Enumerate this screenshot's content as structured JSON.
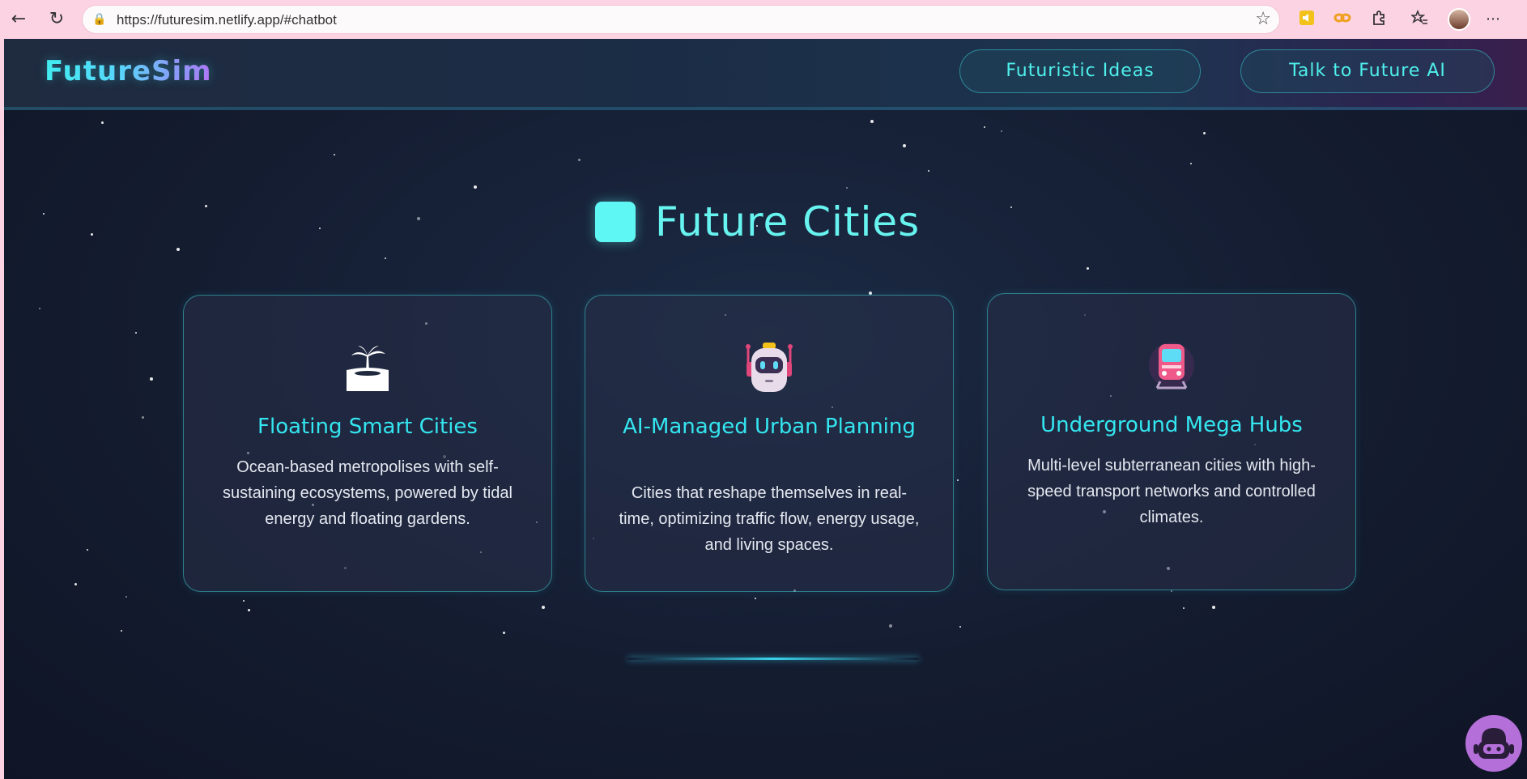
{
  "browser": {
    "url": "https://futuresim.netlify.app/#chatbot"
  },
  "header": {
    "logo": "FutureSim",
    "nav": [
      {
        "label": "Futuristic Ideas"
      },
      {
        "label": "Talk to Future AI"
      }
    ]
  },
  "section": {
    "title": "Future Cities"
  },
  "cards": [
    {
      "icon": "island-icon",
      "title": "Floating Smart Cities",
      "description": "Ocean-based metropolises with self-sustaining ecosystems, powered by tidal energy and floating gardens."
    },
    {
      "icon": "robot-icon",
      "title": "AI-Managed Urban Planning",
      "description": "Cities that reshape themselves in real-time, optimizing traffic flow, energy usage, and living spaces."
    },
    {
      "icon": "metro-train-icon",
      "title": "Underground Mega Hubs",
      "description": "Multi-level subterranean cities with high-speed transport networks and controlled climates."
    }
  ],
  "colors": {
    "accent": "#34e6f0",
    "background": "#141c30",
    "chatbot": "#b46fd9"
  }
}
